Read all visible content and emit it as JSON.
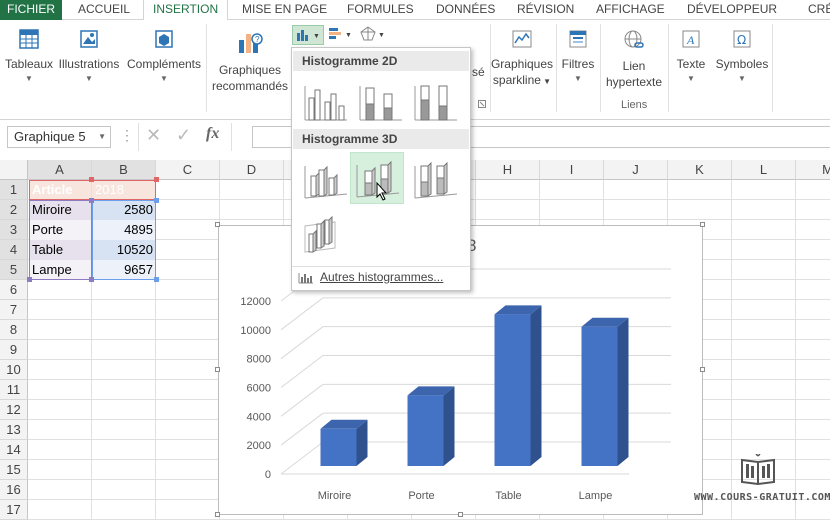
{
  "tabs": [
    {
      "label": "FICHIER"
    },
    {
      "label": "ACCUEIL"
    },
    {
      "label": "INSERTION"
    },
    {
      "label": "MISE EN PAGE"
    },
    {
      "label": "FORMULES"
    },
    {
      "label": "DONNÉES"
    },
    {
      "label": "RÉVISION"
    },
    {
      "label": "AFFICHAGE"
    },
    {
      "label": "DÉVELOPPEUR"
    },
    {
      "label": "CRÉ"
    }
  ],
  "ribbon": {
    "tableaux": "Tableaux",
    "illustrations": "Illustrations",
    "complements": "Compléments",
    "graphiques_rec_1": "Graphiques",
    "graphiques_rec_2": "recommandés",
    "partial_label": "sé",
    "sparkline_1": "Graphiques",
    "sparkline_2": "sparkline",
    "filtres": "Filtres",
    "lien_1": "Lien",
    "lien_2": "hypertexte",
    "texte": "Texte",
    "symboles": "Symboles",
    "group_liens": "Liens"
  },
  "formula_bar": {
    "name_box": "Graphique 5",
    "fx": "fx"
  },
  "columns": [
    "A",
    "B",
    "C",
    "D",
    "E",
    "F",
    "G",
    "H",
    "I",
    "J",
    "K",
    "L",
    "M"
  ],
  "rows": [
    "1",
    "2",
    "3",
    "4",
    "5",
    "6",
    "7",
    "8",
    "9",
    "10",
    "11",
    "12",
    "13",
    "14",
    "15",
    "16",
    "17"
  ],
  "table": {
    "headers": [
      "Article",
      "2018"
    ],
    "rows": [
      [
        "Miroire",
        "2580"
      ],
      [
        "Porte",
        "4895"
      ],
      [
        "Table",
        "10520"
      ],
      [
        "Lampe",
        "9657"
      ]
    ]
  },
  "dropdown": {
    "section_2d": "Histogramme 2D",
    "section_3d": "Histogramme 3D",
    "more": "Autres histogrammes..."
  },
  "chart_data": {
    "type": "bar",
    "title_fragment": "8",
    "categories": [
      "Miroire",
      "Porte",
      "Table",
      "Lampe"
    ],
    "values": [
      2580,
      4895,
      10520,
      9657
    ],
    "ylim": [
      0,
      12000
    ],
    "yticks": [
      "12000",
      "10000",
      "8000",
      "6000",
      "4000",
      "2000",
      "0"
    ],
    "bar_color": "#4472C4",
    "grid": true,
    "style": "3d-column"
  },
  "watermark": "WWW.COURS-GRATUIT.COM",
  "colors": {
    "excel_green": "#217346",
    "bar_front": "#4472C4",
    "bar_side": "#2F528F",
    "bar_top": "#3C65AE"
  }
}
